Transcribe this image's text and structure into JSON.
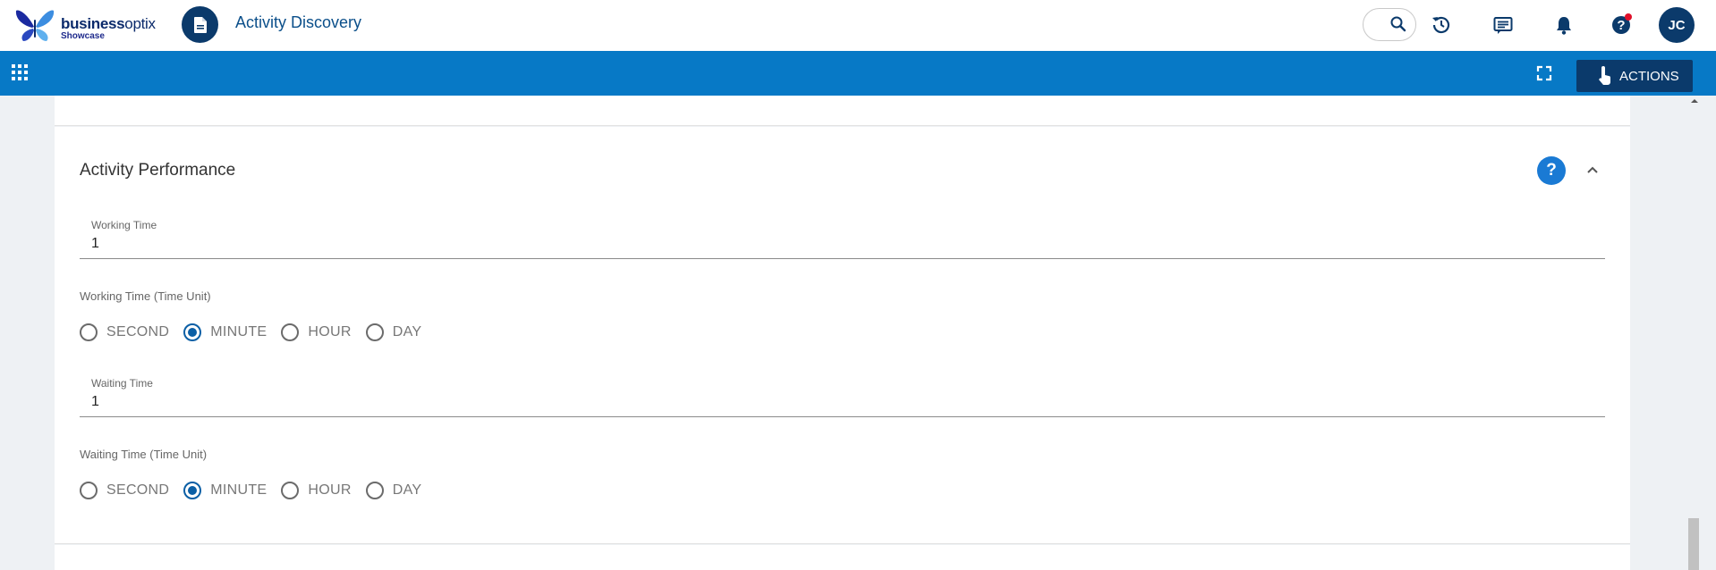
{
  "header": {
    "brand_name": "businessoptix",
    "brand_bold": "business",
    "brand_light": "optix",
    "brand_sub": "Showcase",
    "app_title": "Activity Discovery",
    "avatar_initials": "JC",
    "icons": [
      "search-icon",
      "history-icon",
      "comments-icon",
      "bell-icon",
      "help-icon"
    ],
    "notification_color": "#e0102a"
  },
  "toolbar": {
    "actions_label": "ACTIONS",
    "background": "#0779c6"
  },
  "section": {
    "title": "Activity Performance",
    "help_label": "?",
    "working_time": {
      "label": "Working Time",
      "value": "1"
    },
    "working_time_unit": {
      "label": "Working Time (Time Unit)",
      "options": [
        "SECOND",
        "MINUTE",
        "HOUR",
        "DAY"
      ],
      "selected": "MINUTE"
    },
    "waiting_time": {
      "label": "Waiting Time",
      "value": "1"
    },
    "waiting_time_unit": {
      "label": "Waiting Time (Time Unit)",
      "options": [
        "SECOND",
        "MINUTE",
        "HOUR",
        "DAY"
      ],
      "selected": "MINUTE"
    }
  },
  "colors": {
    "primary_dark": "#0b3a6b",
    "accent_blue": "#1a7ad4",
    "radio_selected": "#0b5fa5"
  }
}
